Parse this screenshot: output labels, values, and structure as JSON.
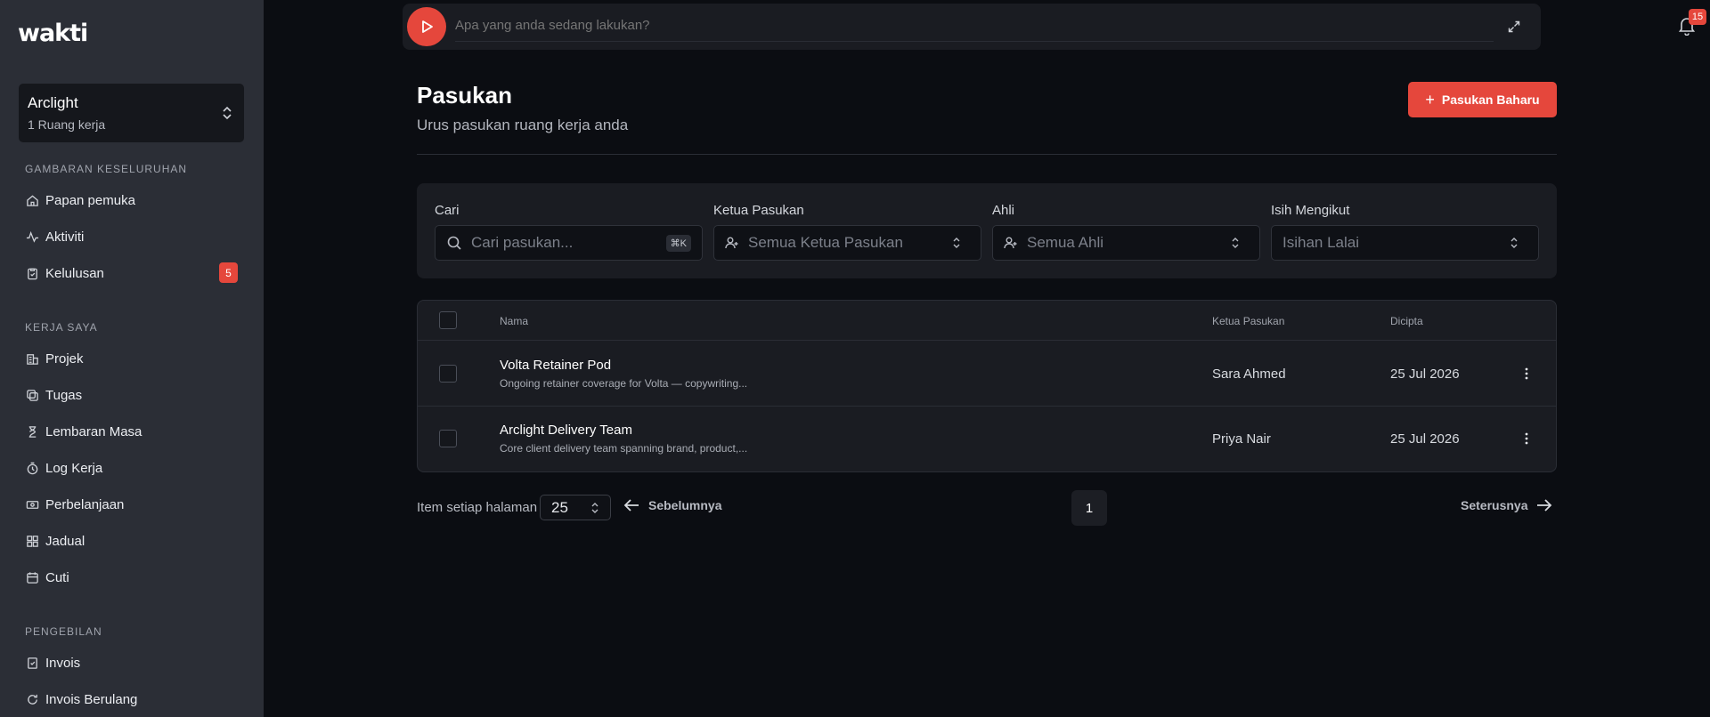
{
  "app": {
    "logo": "wakti"
  },
  "workspace": {
    "name": "Arclight",
    "subtitle": "1 Ruang kerja"
  },
  "sidebar": {
    "sections": [
      {
        "title": "GAMBARAN KESELURUHAN"
      },
      {
        "title": "KERJA SAYA"
      },
      {
        "title": "PENGEBILAN"
      }
    ],
    "items": [
      {
        "label": "Papan pemuka",
        "icon": "home-icon"
      },
      {
        "label": "Aktiviti",
        "icon": "activity-icon"
      },
      {
        "label": "Kelulusan",
        "icon": "clipboard-check-icon",
        "badge": "5"
      },
      {
        "label": "Projek",
        "icon": "building-icon"
      },
      {
        "label": "Tugas",
        "icon": "tasks-icon"
      },
      {
        "label": "Lembaran Masa",
        "icon": "hourglass-icon"
      },
      {
        "label": "Log Kerja",
        "icon": "timer-icon"
      },
      {
        "label": "Perbelanjaan",
        "icon": "banknote-icon"
      },
      {
        "label": "Jadual",
        "icon": "grid-icon"
      },
      {
        "label": "Cuti",
        "icon": "calendar-icon"
      },
      {
        "label": "Invois",
        "icon": "invoice-icon"
      },
      {
        "label": "Invois Berulang",
        "icon": "refresh-icon"
      }
    ]
  },
  "topbar": {
    "placeholder": "Apa yang anda sedang lakukan?",
    "notification_count": "15"
  },
  "page": {
    "title": "Pasukan",
    "subtitle": "Urus pasukan ruang kerja anda",
    "new_button": "Pasukan Baharu"
  },
  "filters": {
    "search": {
      "label": "Cari",
      "placeholder": "Cari pasukan...",
      "shortcut": "⌘K"
    },
    "lead": {
      "label": "Ketua Pasukan",
      "value": "Semua Ketua Pasukan"
    },
    "member": {
      "label": "Ahli",
      "value": "Semua Ahli"
    },
    "sort": {
      "label": "Isih Mengikut",
      "value": "Isihan Lalai"
    }
  },
  "table": {
    "columns": [
      "Nama",
      "Ketua Pasukan",
      "Dicipta"
    ],
    "rows": [
      {
        "name": "Volta Retainer Pod",
        "description": "Ongoing retainer coverage for Volta — copywriting...",
        "lead": "Sara Ahmed",
        "created": "25 Jul 2026"
      },
      {
        "name": "Arclight Delivery Team",
        "description": "Core client delivery team spanning brand, product,...",
        "lead": "Priya Nair",
        "created": "25 Jul 2026"
      }
    ]
  },
  "pagination": {
    "per_page_label": "Item setiap halaman",
    "per_page_value": "25",
    "prev_label": "Sebelumnya",
    "current_page": "1",
    "next_label": "Seterusnya"
  },
  "colors": {
    "accent": "#e5473c",
    "background": "#0b0d12",
    "sidebar": "#2b2e36",
    "panel": "#1a1c22"
  }
}
